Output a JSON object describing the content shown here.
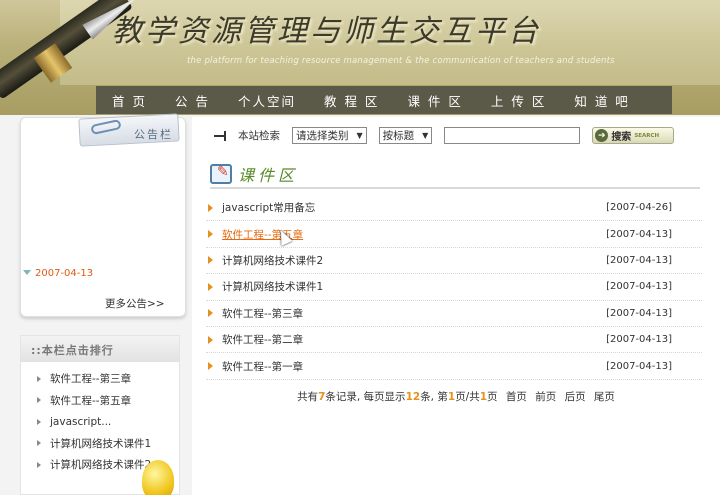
{
  "header": {
    "title": "教学资源管理与师生交互平台",
    "subtitle": "the platform for teaching resource management & the communication of teachers and students"
  },
  "nav": [
    "首 页",
    "公 告",
    "个人空间",
    "教 程 区",
    "课 件 区",
    "上 传 区",
    "知 道 吧"
  ],
  "notice": {
    "title": "公告栏",
    "date": "2007-04-13",
    "more": "更多公告>>"
  },
  "ranking": {
    "title": "::本栏点击排行",
    "items": [
      "软件工程--第三章",
      "软件工程--第五章",
      "javascript...",
      "计算机网络技术课件1",
      "计算机网络技术课件2"
    ]
  },
  "search": {
    "label": "本站检索",
    "category_selected": "请选择类别",
    "field_selected": "按标题",
    "input_value": "",
    "button_label": "搜索",
    "button_en": "SEARCH"
  },
  "section": {
    "title": "课件区"
  },
  "courses": [
    {
      "title": "javascript常用备忘",
      "date": "[2007-04-26]"
    },
    {
      "title": "软件工程--第五章",
      "date": "[2007-04-13]"
    },
    {
      "title": "计算机网络技术课件2",
      "date": "[2007-04-13]"
    },
    {
      "title": "计算机网络技术课件1",
      "date": "[2007-04-13]"
    },
    {
      "title": "软件工程--第三章",
      "date": "[2007-04-13]"
    },
    {
      "title": "软件工程--第二章",
      "date": "[2007-04-13]"
    },
    {
      "title": "软件工程--第一章",
      "date": "[2007-04-13]"
    }
  ],
  "pager": {
    "p1": "共有",
    "total": "7",
    "p2": "条记录, 每页显示",
    "per_page": "12",
    "p3": "条, 第",
    "current": "1",
    "p4": "页/共",
    "pages": "1",
    "p5": "页",
    "first": "首页",
    "prev": "前页",
    "next": "后页",
    "last": "尾页"
  },
  "colors": {
    "nav_bg": "#5b5a48",
    "accent": "#e6901e",
    "hover_link": "#e66a10"
  }
}
